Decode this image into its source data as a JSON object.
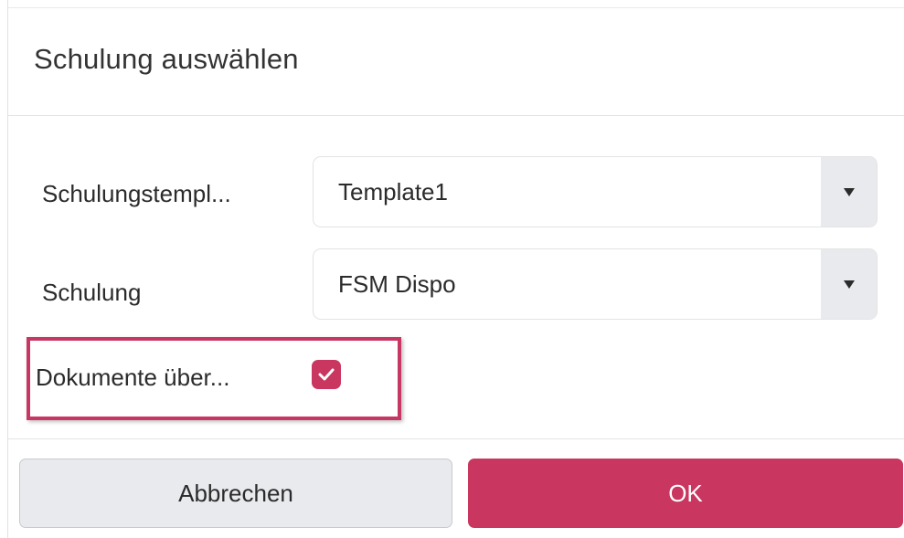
{
  "dialog": {
    "title": "Schulung auswählen"
  },
  "fields": {
    "template": {
      "label": "Schulungstempl...",
      "value": "Template1"
    },
    "schulung": {
      "label": "Schulung",
      "value": "FSM Dispo"
    },
    "dokumente": {
      "label": "Dokumente über...",
      "checked": true
    }
  },
  "buttons": {
    "cancel_label": "Abbrechen",
    "ok_label": "OK"
  },
  "colors": {
    "accent": "#c9365f",
    "highlight_border": "#c73764",
    "secondary_button": "#e9eaee"
  },
  "icons": {
    "dropdown": "caret-down-icon",
    "checkbox": "check-icon"
  }
}
